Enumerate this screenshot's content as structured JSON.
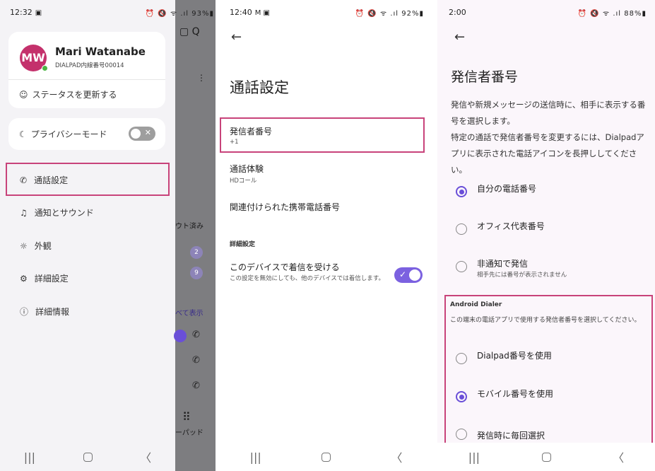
{
  "screen1": {
    "status": {
      "time": "12:32",
      "time_icon": "▣",
      "icons": "⏰ 🔇 ᯤ .ıl 93%▮"
    },
    "scrim": {
      "right_icons": "▢ Q",
      "overflow": "⋮",
      "signed_out": "ウト済み",
      "badge1": "2",
      "badge2": "9",
      "show_all": "べて表示",
      "keypad": "ーパッド",
      "keypad_icon": "⠿"
    },
    "profile": {
      "initials": "MW",
      "name": "Mari Watanabe",
      "extension": "DIALPAD内線番号00014"
    },
    "status_update": "ステータスを更新する",
    "privacy_mode": "プライバシーモード",
    "menu": {
      "call_settings": "通話設定",
      "notifications": "通知とサウンド",
      "appearance": "外観",
      "advanced": "詳細設定",
      "info": "詳細情報"
    },
    "nav": {
      "recents": "|||",
      "back": "〈"
    }
  },
  "screen2": {
    "status": {
      "time": "12:40",
      "time_icon": "M ▣",
      "icons": "⏰ 🔇 ᯤ .ıl 92%▮"
    },
    "title": "通話設定",
    "caller_id": {
      "label": "発信者番号",
      "value": "+1"
    },
    "call_experience": {
      "label": "通話体験",
      "value": "HDコール"
    },
    "linked_mobile": {
      "label": "関連付けられた携帯電話番号"
    },
    "advanced_section": "詳細設定",
    "receive_calls": {
      "label": "このデバイスで着信を受ける",
      "description": "この設定を無効にしても、他のデバイスでは着信します。"
    },
    "nav": {
      "recents": "|||",
      "back": "〈"
    }
  },
  "screen3": {
    "status": {
      "time": "2:00",
      "icons": "⏰ 🔇 ᯤ .ıl 88%▮"
    },
    "title": "発信者番号",
    "description": "発信や新規メッセージの送信時に、相手に表示する番号を選択します。\n特定の通話で発信者番号を変更するには、Dialpadアプリに表示された電話アイコンを長押ししてください。",
    "options": {
      "own_number": "自分の電話番号",
      "office_main": "オフィス代表番号",
      "private": "非通知で発信",
      "private_sub": "相手先には番号が表示されません"
    },
    "android_dialer": {
      "title": "Android Dialer",
      "description": "この端末の電話アプリで使用する発信者番号を選択してください。",
      "use_dialpad": "Dialpad番号を使用",
      "use_mobile": "モバイル番号を使用",
      "ask_each_time": "発信時に毎回選択"
    },
    "nav": {
      "recents": "|||",
      "back": "〈"
    }
  },
  "colors": {
    "highlight": "#c8437a",
    "accent": "#6a4fd8",
    "avatar": "#c4316c"
  }
}
